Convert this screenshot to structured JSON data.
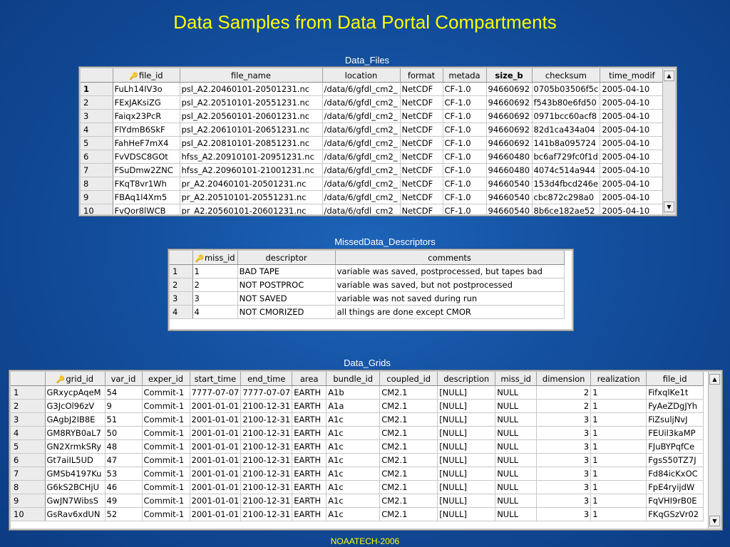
{
  "slide": {
    "title": "Data Samples from Data Portal Compartments",
    "footer": "NOAATECH-2006"
  },
  "data_files": {
    "caption": "Data_Files",
    "columns": [
      "file_id",
      "file_name",
      "location",
      "format",
      "metada",
      "size_b",
      "checksum",
      "time_modif"
    ],
    "rows": [
      [
        "1",
        "FuLh14IV3o",
        "psl_A2.20460101-20501231.nc",
        "/data/6/gfdl_cm2_",
        "NetCDF",
        "CF-1.0",
        "94660692",
        "0705b03506f5c",
        "2005-04-10"
      ],
      [
        "2",
        "FExJAKsiZG",
        "psl_A2.20510101-20551231.nc",
        "/data/6/gfdl_cm2_",
        "NetCDF",
        "CF-1.0",
        "94660692",
        "f543b80e6fd50",
        "2005-04-10"
      ],
      [
        "3",
        "Faiqx23PcR",
        "psl_A2.20560101-20601231.nc",
        "/data/6/gfdl_cm2_",
        "NetCDF",
        "CF-1.0",
        "94660692",
        "0971bcc60acf8",
        "2005-04-10"
      ],
      [
        "4",
        "FlYdmB6SkF",
        "psl_A2.20610101-20651231.nc",
        "/data/6/gfdl_cm2_",
        "NetCDF",
        "CF-1.0",
        "94660692",
        "82d1ca434a04",
        "2005-04-10"
      ],
      [
        "5",
        "FahHeF7mX4",
        "psl_A2.20810101-20851231.nc",
        "/data/6/gfdl_cm2_",
        "NetCDF",
        "CF-1.0",
        "94660692",
        "141b8a095724",
        "2005-04-10"
      ],
      [
        "6",
        "FvVDSC8GOt",
        "hfss_A2.20910101-20951231.nc",
        "/data/6/gfdl_cm2_",
        "NetCDF",
        "CF-1.0",
        "94660480",
        "bc6af729fc0f1d",
        "2005-04-10"
      ],
      [
        "7",
        "FSuDmw2ZNC",
        "hfss_A2.20960101-21001231.nc",
        "/data/6/gfdl_cm2_",
        "NetCDF",
        "CF-1.0",
        "94660480",
        "4074c514a944",
        "2005-04-10"
      ],
      [
        "8",
        "FKqT8vr1Wh",
        "pr_A2.20460101-20501231.nc",
        "/data/6/gfdl_cm2_",
        "NetCDF",
        "CF-1.0",
        "94660540",
        "153d4fbcd246e",
        "2005-04-10"
      ],
      [
        "9",
        "FBAq1l4Xm5",
        "pr_A2.20510101-20551231.nc",
        "/data/6/gfdl_cm2_",
        "NetCDF",
        "CF-1.0",
        "94660540",
        "cbc872c298a0",
        "2005-04-10"
      ],
      [
        "10",
        "FvQor8lWCB",
        "pr_A2.20560101-20601231.nc",
        "/data/6/gfdl_cm2_",
        "NetCDF",
        "CF-1.0",
        "94660540",
        "8b6ce182ae52",
        "2005-04-10"
      ]
    ]
  },
  "missed_data": {
    "caption": "MissedData_Descriptors",
    "columns": [
      "miss_id",
      "descriptor",
      "comments"
    ],
    "rows": [
      [
        "1",
        "1",
        "BAD TAPE",
        "variable was saved, postprocessed, but tapes bad"
      ],
      [
        "2",
        "2",
        "NOT POSTPROC",
        "variable was saved, but not postprocessed"
      ],
      [
        "3",
        "3",
        "NOT SAVED",
        "variable was not saved during run"
      ],
      [
        "4",
        "4",
        "NOT CMORIZED",
        "all things are done except CMOR"
      ]
    ]
  },
  "data_grids": {
    "caption": "Data_Grids",
    "columns": [
      "grid_id",
      "var_id",
      "exper_id",
      "start_time",
      "end_time",
      "area",
      "bundle_id",
      "coupled_id",
      "description",
      "miss_id",
      "dimension",
      "realization",
      "file_id"
    ],
    "rows": [
      [
        "1",
        "GRxycpAqeM",
        "54",
        "Commit-1",
        "7777-07-07",
        "7777-07-07",
        "EARTH",
        "A1b",
        "CM2.1",
        "[NULL]",
        "NULL",
        "2",
        "1",
        "FifxqlKe1t"
      ],
      [
        "2",
        "G3JcOl96zV",
        "9",
        "Commit-1",
        "2001-01-01",
        "2100-12-31",
        "EARTH",
        "A1a",
        "CM2.1",
        "[NULL]",
        "NULL",
        "2",
        "1",
        "FyAeZDgJYh"
      ],
      [
        "3",
        "GAgbJ2IB8E",
        "51",
        "Commit-1",
        "2001-01-01",
        "2100-12-31",
        "EARTH",
        "A1c",
        "CM2.1",
        "[NULL]",
        "NULL",
        "3",
        "1",
        "FiZsuljNvJ"
      ],
      [
        "4",
        "GM8RYB0aL7",
        "50",
        "Commit-1",
        "2001-01-01",
        "2100-12-31",
        "EARTH",
        "A1c",
        "CM2.1",
        "[NULL]",
        "NULL",
        "3",
        "1",
        "FEUil3kaMP"
      ],
      [
        "5",
        "GN2XrmkSRy",
        "48",
        "Commit-1",
        "2001-01-01",
        "2100-12-31",
        "EARTH",
        "A1c",
        "CM2.1",
        "[NULL]",
        "NULL",
        "3",
        "1",
        "FJuBYPqfCe"
      ],
      [
        "6",
        "Gt7aiIL5UD",
        "47",
        "Commit-1",
        "2001-01-01",
        "2100-12-31",
        "EARTH",
        "A1c",
        "CM2.1",
        "[NULL]",
        "NULL",
        "3",
        "1",
        "FgsS50TZ7J"
      ],
      [
        "7",
        "GMSb4197Ku",
        "53",
        "Commit-1",
        "2001-01-01",
        "2100-12-31",
        "EARTH",
        "A1c",
        "CM2.1",
        "[NULL]",
        "NULL",
        "3",
        "1",
        "Fd84icKxOC"
      ],
      [
        "8",
        "G6kS2BCHjU",
        "46",
        "Commit-1",
        "2001-01-01",
        "2100-12-31",
        "EARTH",
        "A1c",
        "CM2.1",
        "[NULL]",
        "NULL",
        "3",
        "1",
        "FpE4ryijdW"
      ],
      [
        "9",
        "GwJN7WibsS",
        "49",
        "Commit-1",
        "2001-01-01",
        "2100-12-31",
        "EARTH",
        "A1c",
        "CM2.1",
        "[NULL]",
        "NULL",
        "3",
        "1",
        "FqVHI9rB0E"
      ],
      [
        "10",
        "GsRav6xdUN",
        "52",
        "Commit-1",
        "2001-01-01",
        "2100-12-31",
        "EARTH",
        "A1c",
        "CM2.1",
        "[NULL]",
        "NULL",
        "3",
        "1",
        "FKqGSzVr02"
      ]
    ]
  },
  "icons": {
    "primary_key": "key-icon",
    "scroll_up": "scroll-up-arrow-icon",
    "scroll_down": "scroll-down-arrow-icon"
  },
  "colors": {
    "title": "#ffff00",
    "background": "#134f9e",
    "caption": "#ffffff"
  }
}
